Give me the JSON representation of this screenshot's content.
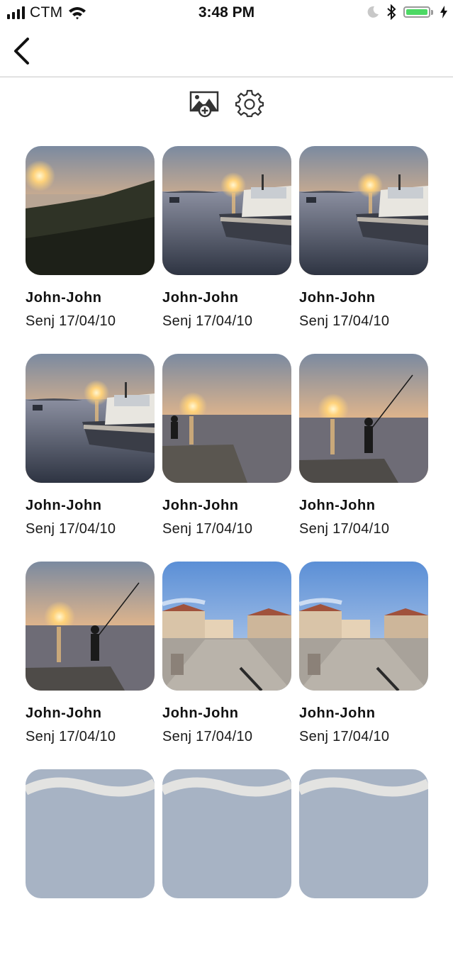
{
  "status_bar": {
    "carrier": "CTM",
    "time": "3:48 PM",
    "icons": [
      "signal-icon",
      "wifi-icon",
      "moon-icon",
      "bluetooth-icon",
      "battery-icon",
      "charging-icon"
    ],
    "battery_level": 1.0,
    "battery_color": "#4cd964"
  },
  "nav": {
    "back_icon": "chevron-left-icon"
  },
  "toolbar": {
    "icons": [
      "add-photo-icon",
      "gear-icon"
    ]
  },
  "photos": [
    {
      "title": "John-John",
      "subtitle": "Senj 17/04/10",
      "scene": "hillside-sunset"
    },
    {
      "title": "John-John",
      "subtitle": "Senj 17/04/10",
      "scene": "boat-sunset"
    },
    {
      "title": "John-John",
      "subtitle": "Senj 17/04/10",
      "scene": "boat-sunset"
    },
    {
      "title": "John-John",
      "subtitle": "Senj 17/04/10",
      "scene": "boat-sunset"
    },
    {
      "title": "John-John",
      "subtitle": "Senj 17/04/10",
      "scene": "pier-sunset"
    },
    {
      "title": "John-John",
      "subtitle": "Senj 17/04/10",
      "scene": "fisherman-sunset"
    },
    {
      "title": "John-John",
      "subtitle": "Senj 17/04/10",
      "scene": "fisherman-sunset"
    },
    {
      "title": "John-John",
      "subtitle": "Senj 17/04/10",
      "scene": "town-promenade"
    },
    {
      "title": "John-John",
      "subtitle": "Senj 17/04/10",
      "scene": "town-promenade"
    },
    {
      "title": "",
      "subtitle": "",
      "scene": "sky-clouds"
    },
    {
      "title": "",
      "subtitle": "",
      "scene": "sky-clouds"
    },
    {
      "title": "",
      "subtitle": "",
      "scene": "sky-clouds"
    }
  ]
}
